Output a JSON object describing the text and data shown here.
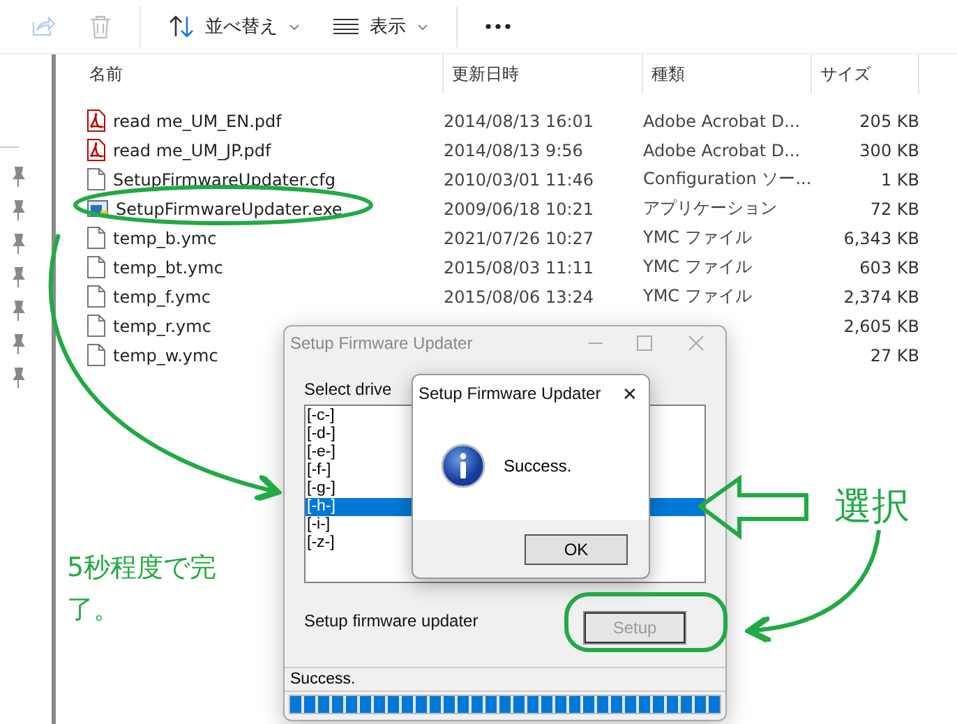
{
  "toolbar": {
    "buttons": [
      {
        "kind": "share",
        "disabled": true
      },
      {
        "kind": "delete",
        "disabled": true
      },
      {
        "kind": "sort",
        "label": "並べ替え",
        "disabled": false
      },
      {
        "kind": "view",
        "label": "表示",
        "disabled": false
      },
      {
        "kind": "more",
        "disabled": false
      }
    ]
  },
  "table": {
    "columns": [
      "名前",
      "更新日時",
      "種類",
      "サイズ"
    ],
    "rows": [
      {
        "kind": "pdf",
        "name": "read me_UM_EN.pdf",
        "date": "2014/08/13 16:01",
        "type": "Adobe Acrobat D...",
        "size": "205 KB"
      },
      {
        "kind": "pdf",
        "name": "read me_UM_JP.pdf",
        "date": "2014/08/13 9:56",
        "type": "Adobe Acrobat D...",
        "size": "300 KB"
      },
      {
        "kind": "file",
        "name": "SetupFirmwareUpdater.cfg",
        "date": "2010/03/01 11:46",
        "type": "Configuration ソー...",
        "size": "1 KB"
      },
      {
        "kind": "exe",
        "name": "SetupFirmwareUpdater.exe",
        "date": "2009/06/18 10:21",
        "type": "アプリケーション",
        "size": "72 KB"
      },
      {
        "kind": "file",
        "name": "temp_b.ymc",
        "date": "2021/07/26 10:27",
        "type": "YMC ファイル",
        "size": "6,343 KB"
      },
      {
        "kind": "file",
        "name": "temp_bt.ymc",
        "date": "2015/08/03 11:11",
        "type": "YMC ファイル",
        "size": "603 KB"
      },
      {
        "kind": "file",
        "name": "temp_f.ymc",
        "date": "2015/08/06 13:24",
        "type": "YMC ファイル",
        "size": "2,374 KB"
      },
      {
        "kind": "file",
        "name": "temp_r.ymc",
        "size": "2,605 KB"
      },
      {
        "kind": "file",
        "name": "temp_w.ymc",
        "size": "27 KB"
      }
    ]
  },
  "dialog": {
    "title": "Setup Firmware Updater",
    "drive_label": "Select drive",
    "drives": [
      {
        "label": "[-c-]",
        "selected": false
      },
      {
        "label": "[-d-]",
        "selected": false
      },
      {
        "label": "[-e-]",
        "selected": false
      },
      {
        "label": "[-f-]",
        "selected": false
      },
      {
        "label": "[-g-]",
        "selected": false
      },
      {
        "label": "[-h-]",
        "selected": true
      },
      {
        "label": "[-i-]",
        "selected": false
      },
      {
        "label": "[-z-]",
        "selected": false
      }
    ],
    "setup_label": "Setup firmware updater",
    "setup_button": {
      "label": "Setup",
      "disabled": true
    },
    "status": "Success.",
    "progress": {
      "level": 1
    }
  },
  "message_box": {
    "title": "Setup Firmware Updater",
    "close": "✕",
    "message": "Success.",
    "button": "OK"
  },
  "annotations": {
    "select_note": "選択",
    "done_note": "5秒程度で完了。"
  }
}
